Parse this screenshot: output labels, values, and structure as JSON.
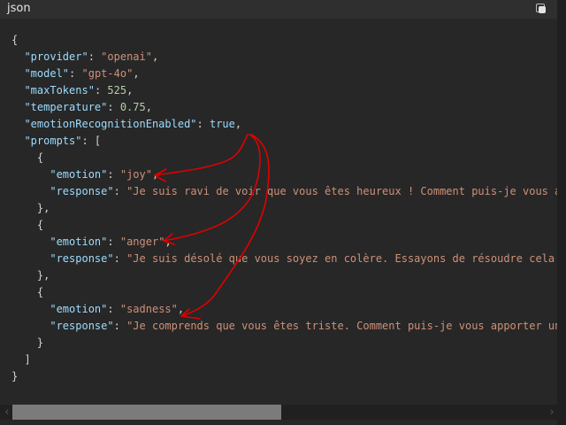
{
  "header": {
    "language": "json",
    "copy_icon": "copy-icon"
  },
  "code": {
    "provider": "openai",
    "model": "gpt-4o",
    "maxTokens": "525",
    "temperature": "0.75",
    "emotionRecognitionEnabled": "true",
    "prompts": [
      {
        "emotion": "joy",
        "response": "Je suis ravi de voir que vous êtes heureux ! Comment puis-je vous aide"
      },
      {
        "emotion": "anger",
        "response": "Je suis désolé que vous soyez en colère. Essayons de résoudre cela ens"
      },
      {
        "emotion": "sadness",
        "response": "Je comprends que vous êtes triste. Comment puis-je vous apporter un po"
      }
    ]
  },
  "annotation": {
    "color": "#e00000"
  },
  "scrollbar": {
    "position_percent": 0
  }
}
